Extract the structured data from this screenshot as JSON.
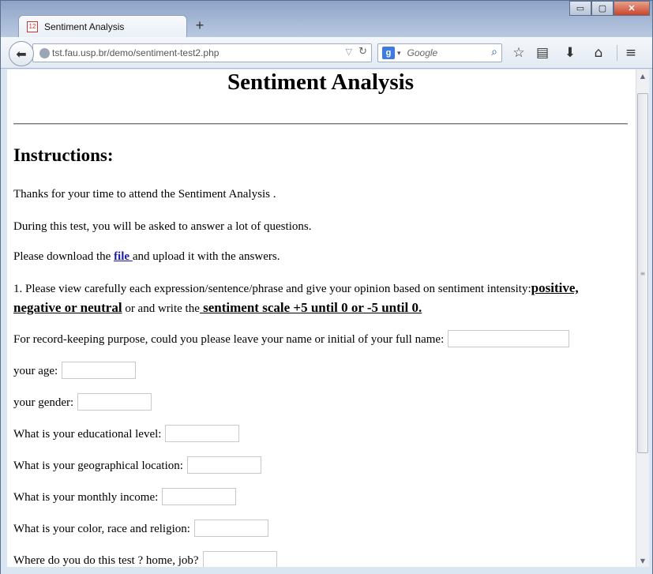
{
  "browser": {
    "tab_title": "Sentiment Analysis",
    "tab_favicon_text": "12",
    "new_tab": "+",
    "url": "tst.fau.usp.br/demo/sentiment-test2.php",
    "search_placeholder": "Google",
    "search_engine_icon": "g-icon",
    "window_controls": {
      "minimize": "▭",
      "maximize": "▢",
      "close": "✕"
    }
  },
  "page": {
    "title": "Sentiment Analysis",
    "instructions_heading": "Instructions:",
    "p1": "Thanks for your time to attend the Sentiment Analysis .",
    "p2": "During this test, you will be asked to answer a lot of questions.",
    "p3_before": "Please download the ",
    "p3_link": "file ",
    "p3_after": "and upload it with the answers.",
    "p4_line1_text": "1. Please view carefully each expression/sentence/phrase and give your opinion based on sentiment intensity:",
    "p4_line1_bold": "positive,",
    "p4_line2_bold": "negative or neutral",
    "p4_line2_mid": " or and write the",
    "p4_line2_bold2": " sentiment scale +5 until 0 or -5 until 0.",
    "questions": {
      "name": "For record-keeping purpose, could you please leave your name or initial of your full name:",
      "age": "your age:",
      "gender": "your gender:",
      "education": "What is your educational level:",
      "location": "What is your geographical location:",
      "income": "What is your monthly income:",
      "color_race_religion": "What is your color, race and religion:",
      "where": "Where do you do this test ? home, job?"
    }
  }
}
